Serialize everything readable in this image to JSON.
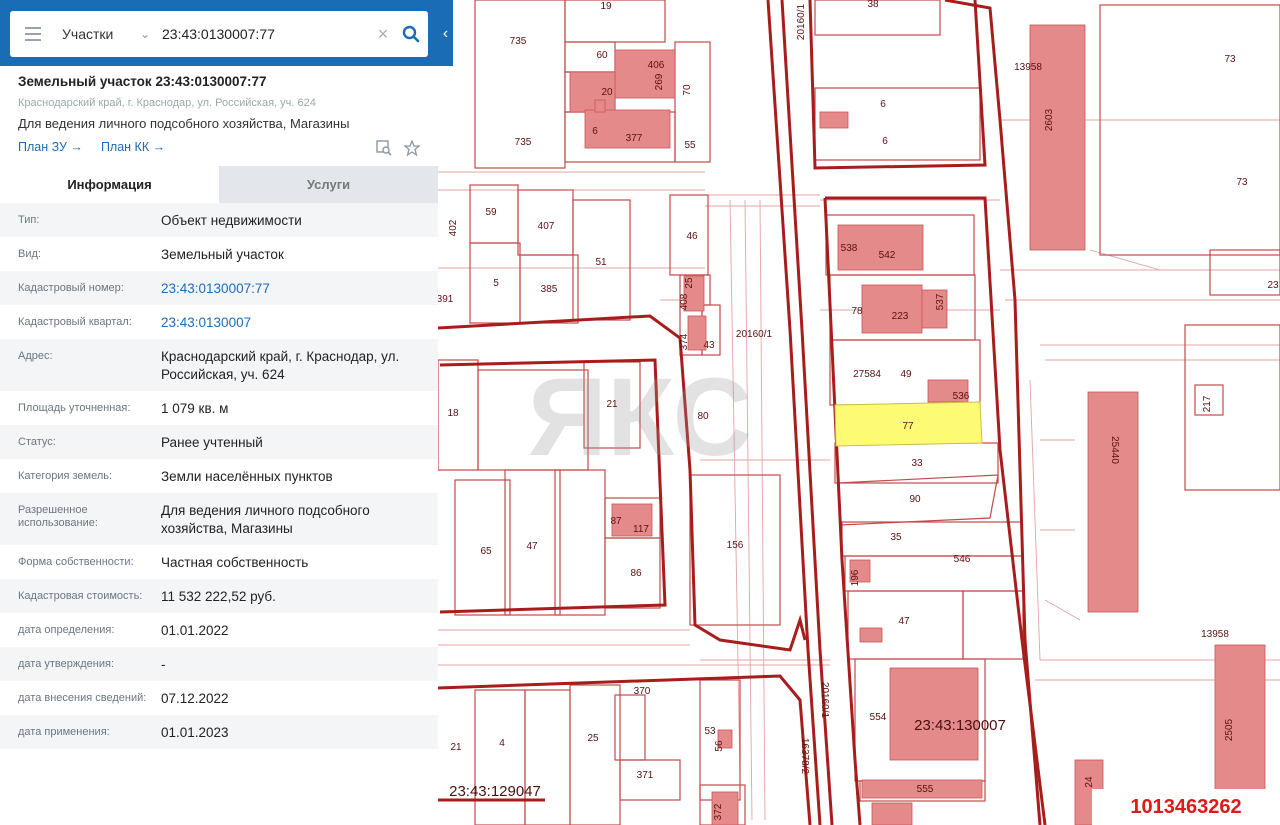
{
  "search": {
    "layer": "Участки",
    "query": "23:43:0130007:77"
  },
  "parcel": {
    "title": "Земельный участок 23:43:0130007:77",
    "address_short": "Краснодарский край, г. Краснодар, ул. Российская, уч. 624",
    "use": "Для ведения личного подсобного хозяйства, Магазины",
    "link_plan_zu": "План ЗУ →",
    "link_plan_kk": "План КК →"
  },
  "tabs": [
    {
      "label": "Информация",
      "active": true
    },
    {
      "label": "Услуги",
      "active": false
    }
  ],
  "info": [
    {
      "key": "Тип:",
      "value": "Объект недвижимости"
    },
    {
      "key": "Вид:",
      "value": "Земельный участок"
    },
    {
      "key": "Кадастровый номер:",
      "value": "23:43:0130007:77",
      "link": true
    },
    {
      "key": "Кадастровый квартал:",
      "value": "23:43:0130007",
      "link": true
    },
    {
      "key": "Адрес:",
      "value": "Краснодарский край, г. Краснодар, ул. Российская, уч. 624"
    },
    {
      "key": "Площадь уточненная:",
      "value": "1 079 кв. м"
    },
    {
      "key": "Статус:",
      "value": "Ранее учтенный"
    },
    {
      "key": "Категория земель:",
      "value": "Земли населённых пунктов"
    },
    {
      "key": "Разрешенное использование:",
      "value": "Для ведения личного подсобного хозяйства, Магазины"
    },
    {
      "key": "Форма собственности:",
      "value": "Частная собственность"
    },
    {
      "key": "Кадастровая стоимость:",
      "value": "11 532 222,52 руб."
    },
    {
      "key": "дата определения:",
      "value": "01.01.2022"
    },
    {
      "key": "дата утверждения:",
      "value": "-"
    },
    {
      "key": "дата внесения сведений:",
      "value": "07.12.2022"
    },
    {
      "key": "дата применения:",
      "value": "01.01.2023"
    }
  ],
  "map": {
    "labels": {
      "l19": "19",
      "l38": "38",
      "l735a": "735",
      "l735b": "735",
      "l60": "60",
      "l406": "406",
      "l269": "269",
      "l70": "70",
      "l20": "20",
      "l6a": "6",
      "l377": "377",
      "l55": "55",
      "l6b": "6",
      "l6c": "6",
      "l73a": "73",
      "l73b": "73",
      "l13958a": "13958",
      "l2603": "2603",
      "l402": "402",
      "l59": "59",
      "l407": "407",
      "l46": "46",
      "l538": "538",
      "l542": "542",
      "l23_right": "23",
      "l391": "391",
      "l5": "5",
      "l385": "385",
      "l51": "51",
      "l25a": "25",
      "l408": "408",
      "l78": "78",
      "l223": "223",
      "l537": "537",
      "l374": "374",
      "l43": "43",
      "l20160a": "20160/1",
      "l27584": "27584",
      "l49": "49",
      "l536": "536",
      "l217": "217",
      "l25440": "25440",
      "l18": "18",
      "l21a": "21",
      "l80": "80",
      "l77": "77",
      "l33": "33",
      "l90": "90",
      "l87": "87",
      "l117": "117",
      "l65": "65",
      "l47a": "47",
      "l86": "86",
      "l156": "156",
      "l35": "35",
      "l546": "546",
      "l196": "196",
      "l47b": "47",
      "l13958b": "13958",
      "l370": "370",
      "l20160b": "20160/1",
      "l554": "554",
      "l21b": "21",
      "l4": "4",
      "l25b": "25",
      "l53": "53",
      "l56": "56",
      "l371": "371",
      "l16378": "16378/2",
      "l555": "555",
      "l372": "372",
      "l2505": "2505",
      "l2401": "24",
      "l20160c": "20160/1"
    },
    "quarter_main": "23:43:130007",
    "quarter_left": "23:43:129047",
    "watermark": "ЯКС"
  },
  "listing_id": "1013463262",
  "colors": {
    "header": "#1a6db5",
    "link": "#1c6cb8",
    "parcel_line": "#c24a4a",
    "building": "#e58a8a",
    "selected": "#fdfb74",
    "id_badge": "#e01818"
  }
}
